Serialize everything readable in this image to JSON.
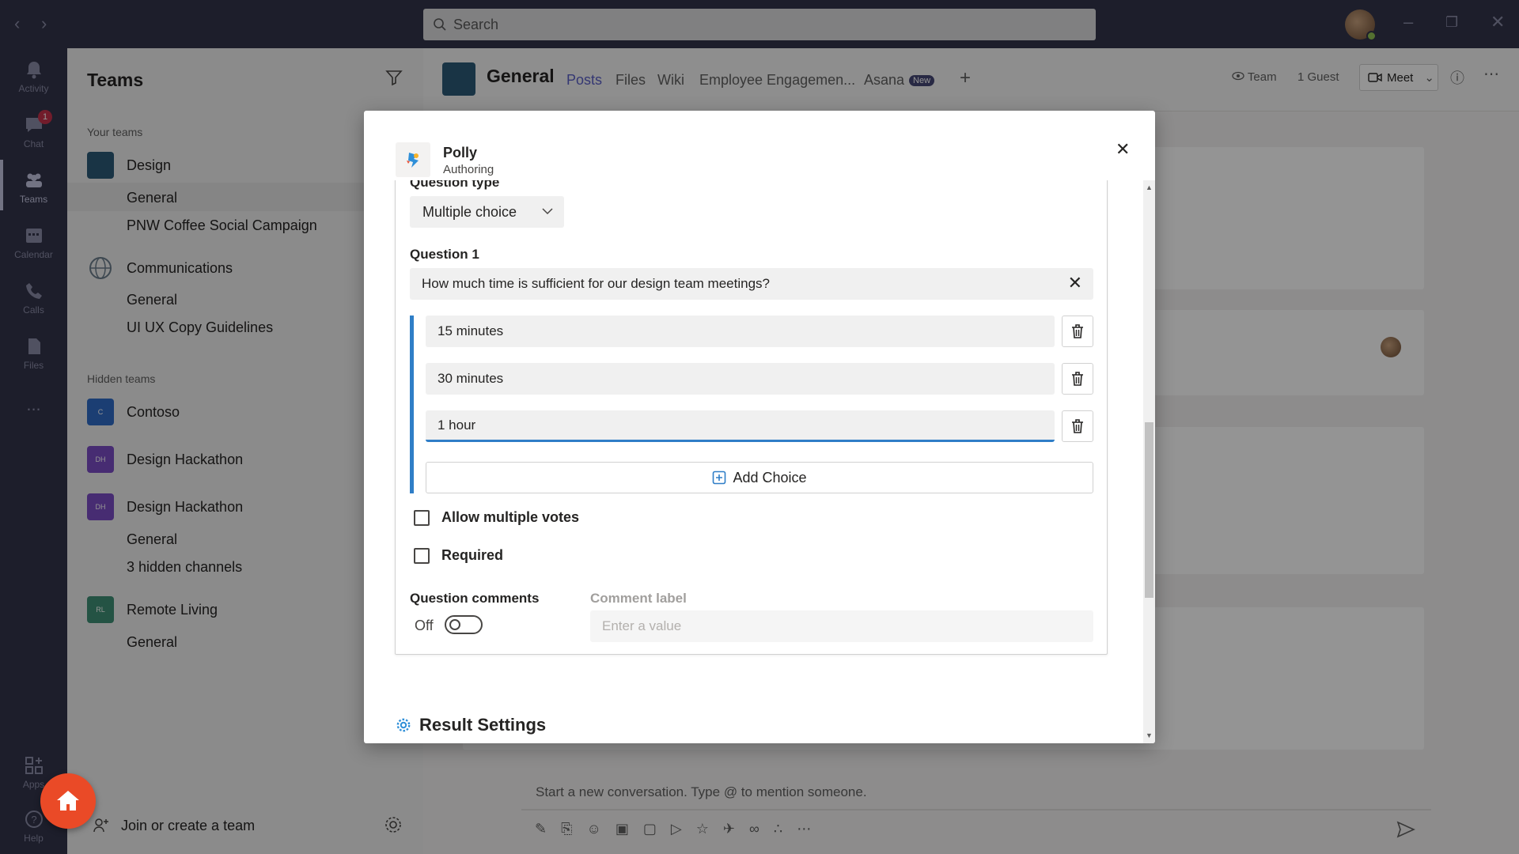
{
  "titlebar": {
    "search_placeholder": "Search",
    "back_icon": "chevron-left-icon",
    "forward_icon": "chevron-right-icon"
  },
  "rail": {
    "items": [
      {
        "label": "Activity",
        "icon": "bell-icon"
      },
      {
        "label": "Chat",
        "icon": "chat-icon",
        "badge": "1"
      },
      {
        "label": "Teams",
        "icon": "teams-icon"
      },
      {
        "label": "Calendar",
        "icon": "calendar-icon"
      },
      {
        "label": "Calls",
        "icon": "phone-icon"
      },
      {
        "label": "Files",
        "icon": "files-icon"
      },
      {
        "label": "...",
        "icon": "more-icon"
      }
    ],
    "bottom": [
      {
        "label": "Apps",
        "icon": "apps-icon"
      },
      {
        "label": "Help",
        "icon": "help-icon"
      }
    ],
    "active": "Teams"
  },
  "sidebar": {
    "title": "Teams",
    "your_teams_label": "Your teams",
    "hidden_teams_label": "Hidden teams",
    "teams": [
      {
        "name": "Design",
        "initials": "",
        "color": "#2b5a78",
        "channels": [
          "General",
          "PNW Coffee Social Campaign"
        ],
        "selected_channel": "General"
      },
      {
        "name": "Communications",
        "initials": "",
        "color": "#6b7d8c",
        "channels": [
          "General",
          "UI UX Copy Guidelines"
        ]
      }
    ],
    "hidden_teams": [
      {
        "name": "Contoso",
        "initials": "C",
        "color": "#2f6cc7",
        "channels": []
      },
      {
        "name": "Design Hackathon",
        "initials": "DH",
        "color": "#7a4cc4",
        "channels": []
      },
      {
        "name": "Design Hackathon",
        "initials": "DH",
        "color": "#7a4cc4",
        "channels": [
          "General",
          "3 hidden channels"
        ]
      },
      {
        "name": "Remote Living",
        "initials": "RL",
        "color": "#3e8f75",
        "channels": [
          "General"
        ]
      }
    ],
    "join_label": "Join or create a team"
  },
  "channel_header": {
    "title": "General",
    "tabs": [
      "Posts",
      "Files",
      "Wiki",
      "Employee Engagemen...",
      "Asana"
    ],
    "active_tab": "Posts",
    "new_badge": "New",
    "team_label": "Team",
    "guest_label": "1 Guest",
    "meet_label": "Meet"
  },
  "compose": {
    "placeholder": "Start a new conversation. Type @ to mention someone."
  },
  "dialog": {
    "app_name": "Polly",
    "app_subtitle": "Authoring",
    "question_type_label": "Question type",
    "question_type_value": "Multiple choice",
    "question_label": "Question 1",
    "question_text": "How much time is sufficient for our design team meetings?",
    "choices": [
      "15 minutes",
      "30 minutes",
      "1 hour"
    ],
    "add_choice_label": "Add Choice",
    "allow_multiple_votes_label": "Allow multiple votes",
    "allow_multiple_votes_checked": false,
    "required_label": "Required",
    "required_checked": false,
    "question_comments_label": "Question comments",
    "comments_toggle_label": "Off",
    "comments_enabled": false,
    "comment_label_title": "Comment label",
    "comment_label_placeholder": "Enter a value",
    "result_settings_label": "Result Settings"
  },
  "colors": {
    "accent": "#5b5fc7",
    "choice_accent": "#2f7ec7",
    "titlebar": "#33344a",
    "home_fab": "#ea4a27"
  }
}
